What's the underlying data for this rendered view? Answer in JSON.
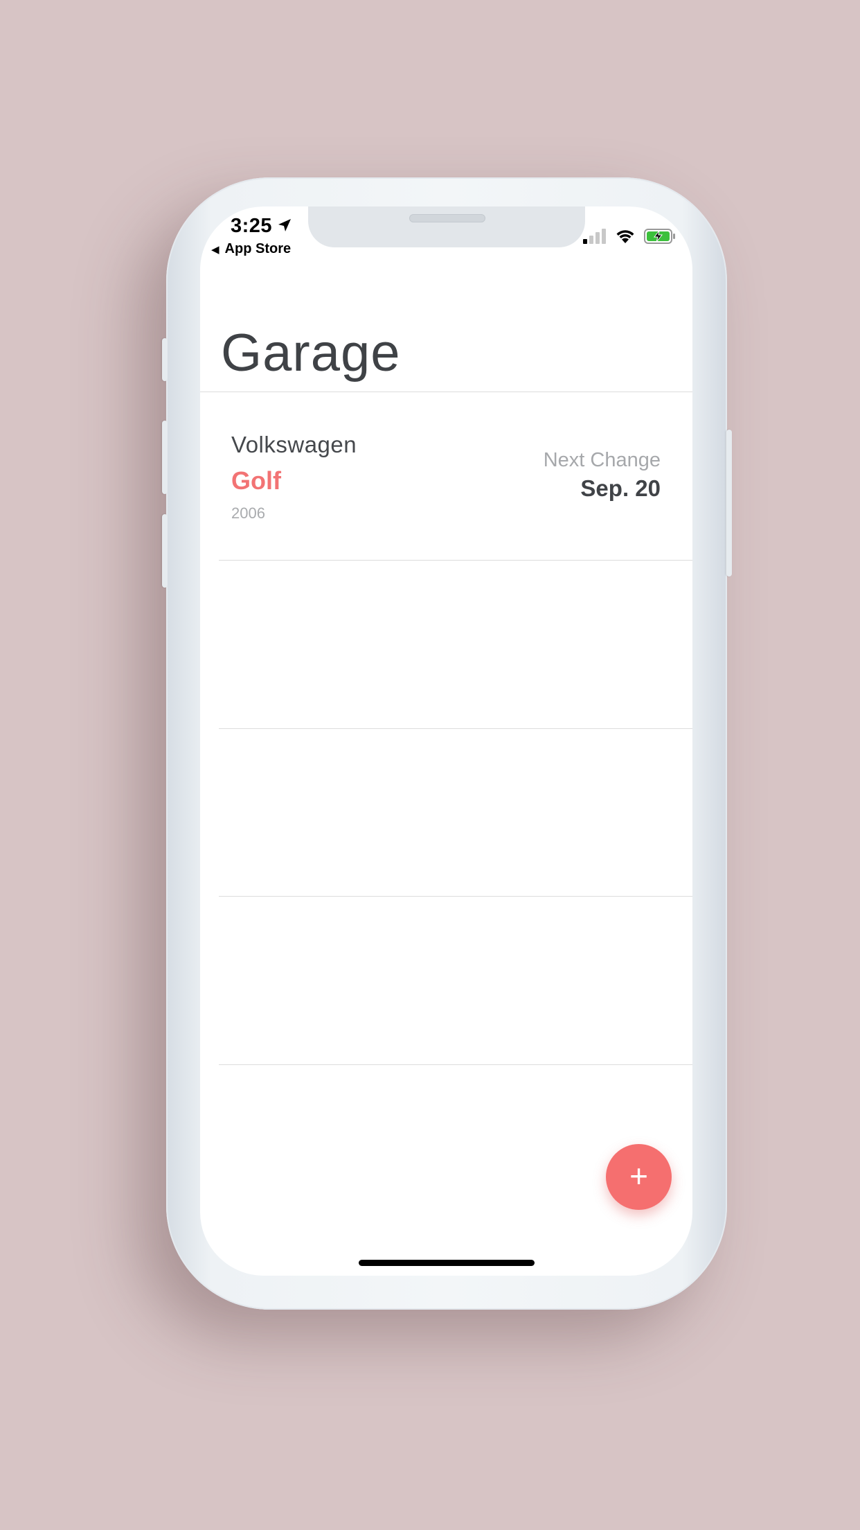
{
  "status_bar": {
    "time": "3:25",
    "back_app": "App Store",
    "battery_color": "#3cc03c"
  },
  "screen": {
    "title": "Garage"
  },
  "cars": [
    {
      "make": "Volkswagen",
      "model": "Golf",
      "year": "2006",
      "next_change_label": "Next Change",
      "next_change_date": "Sep. 20"
    }
  ],
  "fab": {
    "label": "+",
    "color": "#f56f6f"
  },
  "icons": {
    "location": "location-arrow-icon",
    "signal": "cellular-signal-icon",
    "wifi": "wifi-icon",
    "battery": "battery-charging-icon",
    "back": "back-arrow-icon"
  }
}
